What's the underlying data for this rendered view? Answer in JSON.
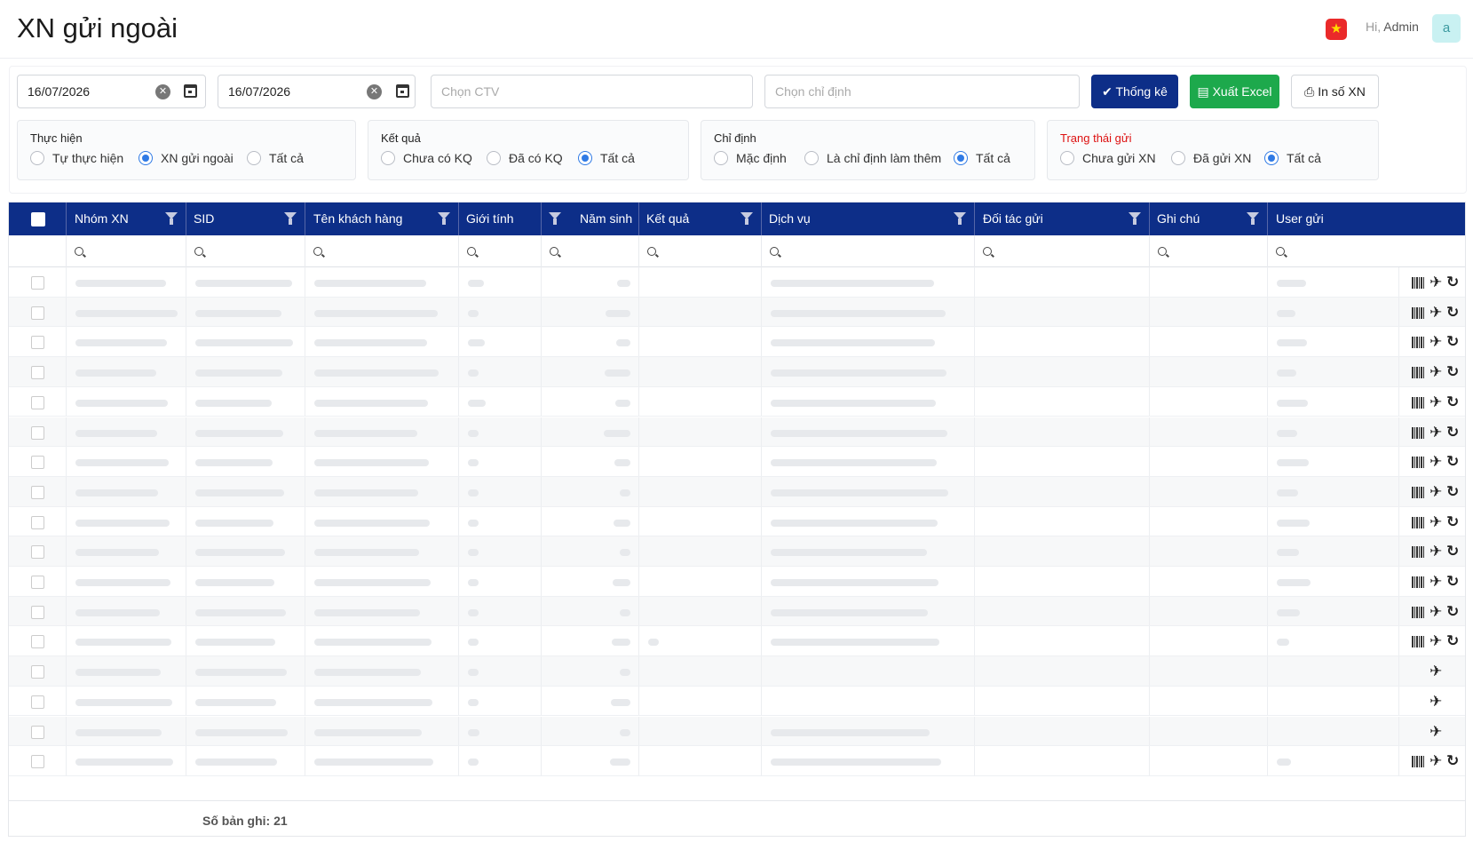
{
  "page": {
    "title": "XN gửi ngoài"
  },
  "header": {
    "greeting": "Hi,",
    "user": "Admin",
    "avatar_letter": "a",
    "flag_icon": "vietnam-flag-icon"
  },
  "filters": {
    "from_date": "16/07/2026",
    "to_date": "16/07/2026",
    "ctv_placeholder": "Chọn CTV",
    "chi_dinh_placeholder": "Chọn chỉ định"
  },
  "buttons": {
    "thong_ke": "Thống kê",
    "xuat_excel": "Xuất Excel",
    "in_so_xn": "In số XN"
  },
  "groups": [
    {
      "title": "Thực hiện",
      "options": [
        "Tự thực hiện",
        "XN gửi ngoài",
        "Tất cả"
      ],
      "selected": 1
    },
    {
      "title": "Kết quả",
      "options": [
        "Chưa có KQ",
        "Đã có KQ",
        "Tất cả"
      ],
      "selected": 2
    },
    {
      "title": "Chỉ định",
      "options": [
        "Mặc định",
        "Là chỉ định làm thêm",
        "Tất cả"
      ],
      "selected": 2
    },
    {
      "title": "Trạng thái gửi",
      "options": [
        "Chưa gửi XN",
        "Đã gửi XN",
        "Tất cả"
      ],
      "selected": 2,
      "title_color": "#dd1111"
    }
  ],
  "table": {
    "columns": [
      "Nhóm XN",
      "SID",
      "Tên khách hàng",
      "Giới tính",
      "Năm sinh",
      "Kết quả",
      "Dịch vụ",
      "Đối tác gửi",
      "Ghi chú",
      "User gửi"
    ],
    "row_count": 17,
    "rows_with_barcode_undo": [
      0,
      1,
      2,
      3,
      4,
      5,
      6,
      7,
      8,
      9,
      10,
      11,
      12,
      16
    ],
    "rows_plane_only": [
      13,
      14,
      15
    ]
  },
  "footer": {
    "record_count": "Số bản ghi: 21"
  },
  "colors": {
    "header_bg": "#0d2e88",
    "excel_green": "#1da94c",
    "radio_blue": "#2f7ae5"
  }
}
